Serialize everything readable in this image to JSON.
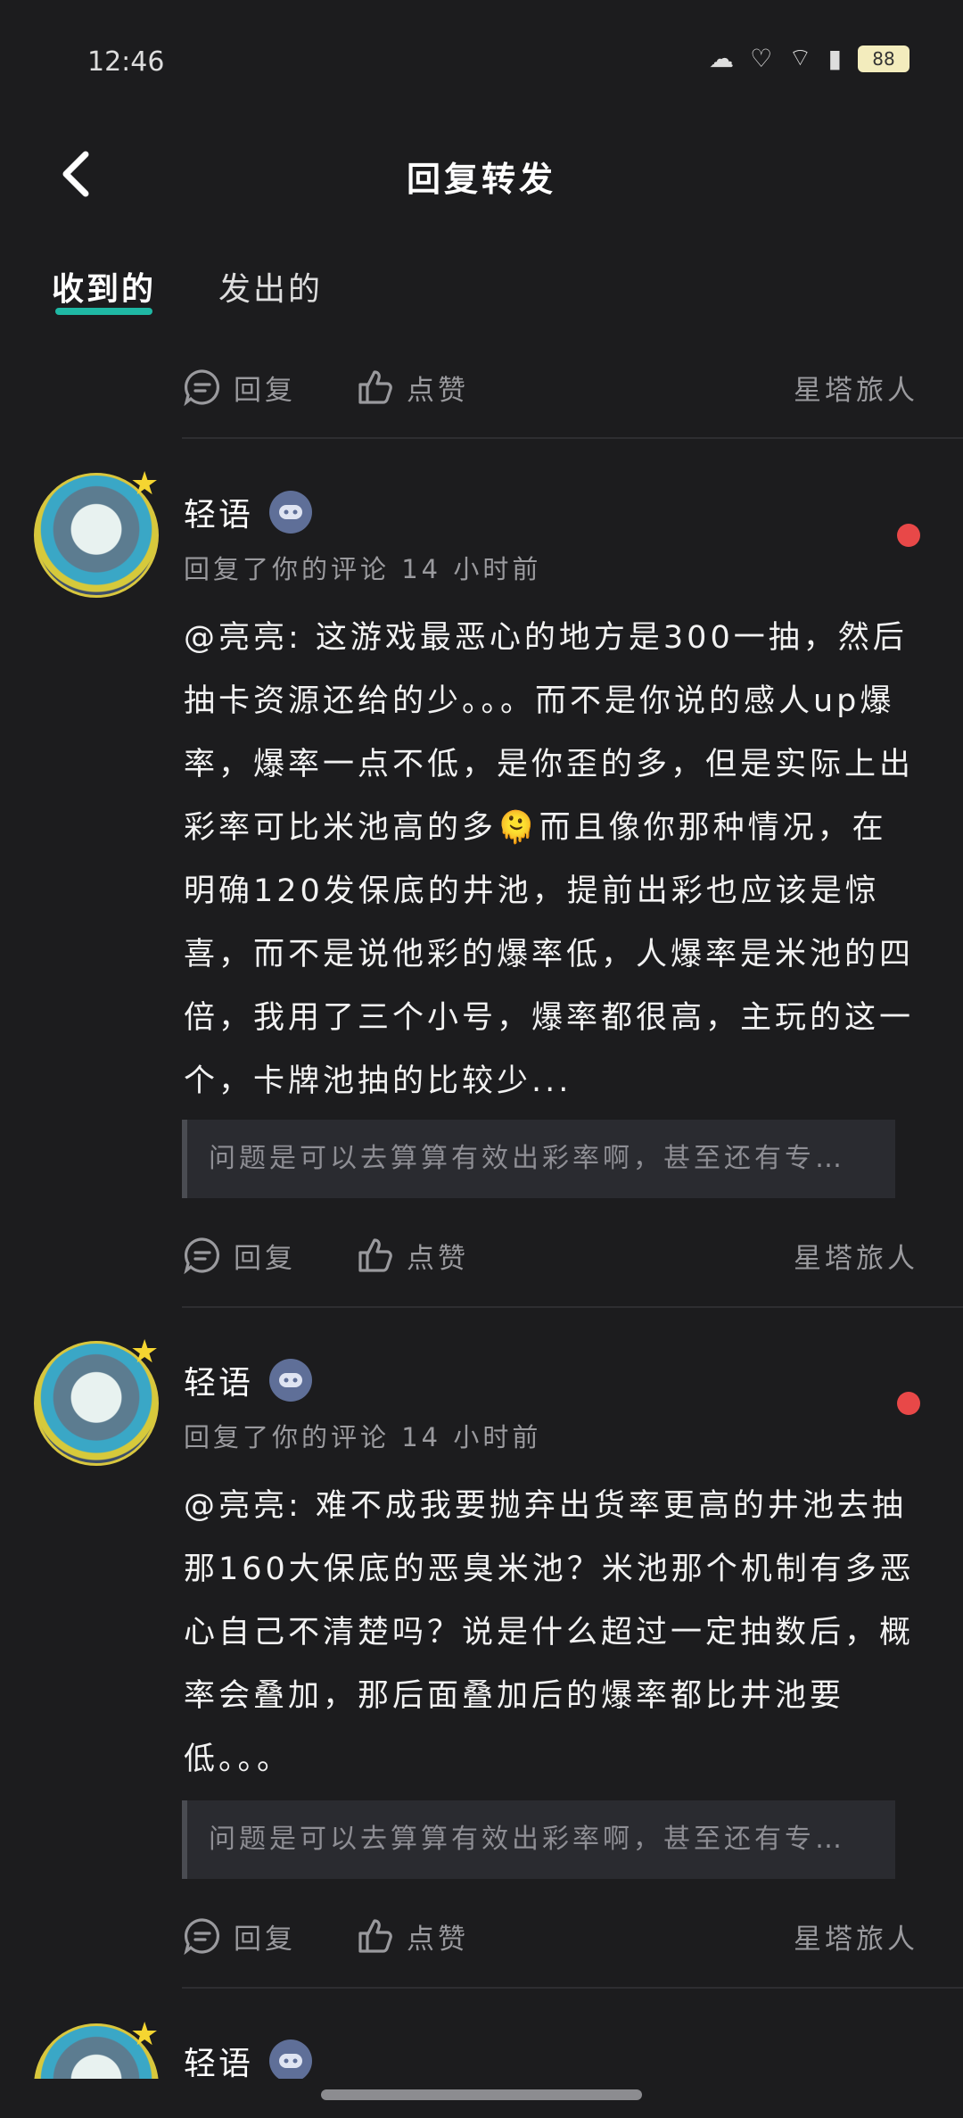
{
  "status": {
    "time": "12:46",
    "battery": "88"
  },
  "header": {
    "title": "回复转发"
  },
  "tabs": [
    {
      "label": "收到的"
    },
    {
      "label": "发出的"
    }
  ],
  "actions": {
    "reply": "回复",
    "like": "点赞",
    "source": "星塔旅人"
  },
  "cards": [
    {
      "author": "轻语",
      "meta": "回复了你的评论 14 小时前",
      "content": "@亮亮: 这游戏最恶心的地方是300一抽，然后抽卡资源还给的少。。。而不是你说的感人up爆率，爆率一点不低，是你歪的多，但是实际上出彩率可比米池高的多🫠而且像你那种情况，在明确120发保底的井池，提前出彩也应该是惊喜，而不是说他彩的爆率低，人爆率是米池的四倍，我用了三个小号，爆率都很高，主玩的这一个，卡牌池抽的比较少...",
      "quote": "问题是可以去算算有效出彩率啊，甚至还有专…"
    },
    {
      "author": "轻语",
      "meta": "回复了你的评论 14 小时前",
      "content": "@亮亮: 难不成我要抛弃出货率更高的井池去抽那160大保底的恶臭米池？米池那个机制有多恶心自己不清楚吗？说是什么超过一定抽数后，概率会叠加，那后面叠加后的爆率都比井池要低。。。",
      "quote": "问题是可以去算算有效出彩率啊，甚至还有专…"
    },
    {
      "author": "轻语"
    }
  ]
}
